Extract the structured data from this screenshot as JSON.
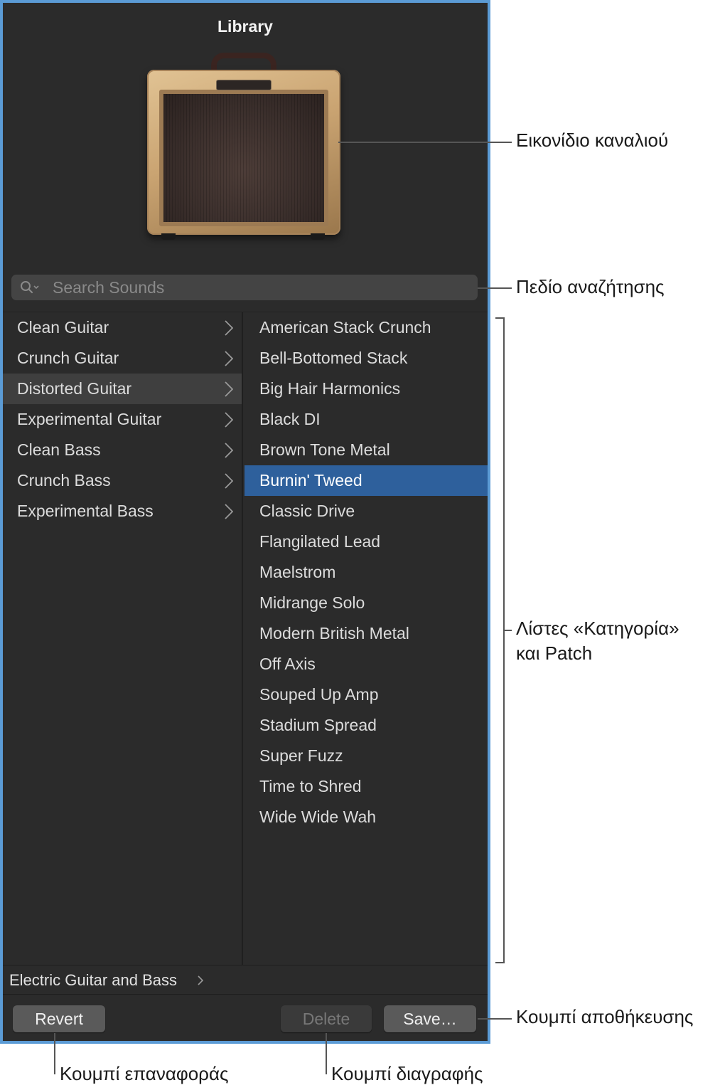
{
  "library": {
    "title": "Library",
    "search": {
      "placeholder": "Search Sounds",
      "value": ""
    },
    "categories": [
      {
        "label": "Clean Guitar",
        "selected": false
      },
      {
        "label": "Crunch Guitar",
        "selected": false
      },
      {
        "label": "Distorted Guitar",
        "selected": true
      },
      {
        "label": "Experimental Guitar",
        "selected": false
      },
      {
        "label": "Clean Bass",
        "selected": false
      },
      {
        "label": "Crunch Bass",
        "selected": false
      },
      {
        "label": "Experimental Bass",
        "selected": false
      }
    ],
    "patches": [
      {
        "label": "American Stack Crunch",
        "selected": false
      },
      {
        "label": "Bell-Bottomed Stack",
        "selected": false
      },
      {
        "label": "Big Hair Harmonics",
        "selected": false
      },
      {
        "label": "Black DI",
        "selected": false
      },
      {
        "label": "Brown Tone Metal",
        "selected": false
      },
      {
        "label": "Burnin' Tweed",
        "selected": true
      },
      {
        "label": "Classic Drive",
        "selected": false
      },
      {
        "label": "Flangilated Lead",
        "selected": false
      },
      {
        "label": "Maelstrom",
        "selected": false
      },
      {
        "label": "Midrange Solo",
        "selected": false
      },
      {
        "label": "Modern British Metal",
        "selected": false
      },
      {
        "label": "Off Axis",
        "selected": false
      },
      {
        "label": "Souped Up Amp",
        "selected": false
      },
      {
        "label": "Stadium Spread",
        "selected": false
      },
      {
        "label": "Super Fuzz",
        "selected": false
      },
      {
        "label": "Time to Shred",
        "selected": false
      },
      {
        "label": "Wide Wide Wah",
        "selected": false
      }
    ],
    "breadcrumb": "Electric Guitar and Bass",
    "buttons": {
      "revert": "Revert",
      "delete": "Delete",
      "save": "Save…"
    },
    "channel_icon": "guitar-amp-icon"
  },
  "callouts": {
    "channel_icon": "Εικονίδιο καναλιού",
    "search_field": "Πεδίο αναζήτησης",
    "lists_line1": "Λίστες «Κατηγορία»",
    "lists_line2": "και Patch",
    "save_button": "Κουμπί αποθήκευσης",
    "revert_button": "Κουμπί επαναφοράς",
    "delete_button": "Κουμπί διαγραφής"
  },
  "colors": {
    "panel_border": "#5b9bd5",
    "panel_bg": "#2b2b2b",
    "selected_patch": "#2e609c",
    "selected_category": "#3f3f3f"
  }
}
